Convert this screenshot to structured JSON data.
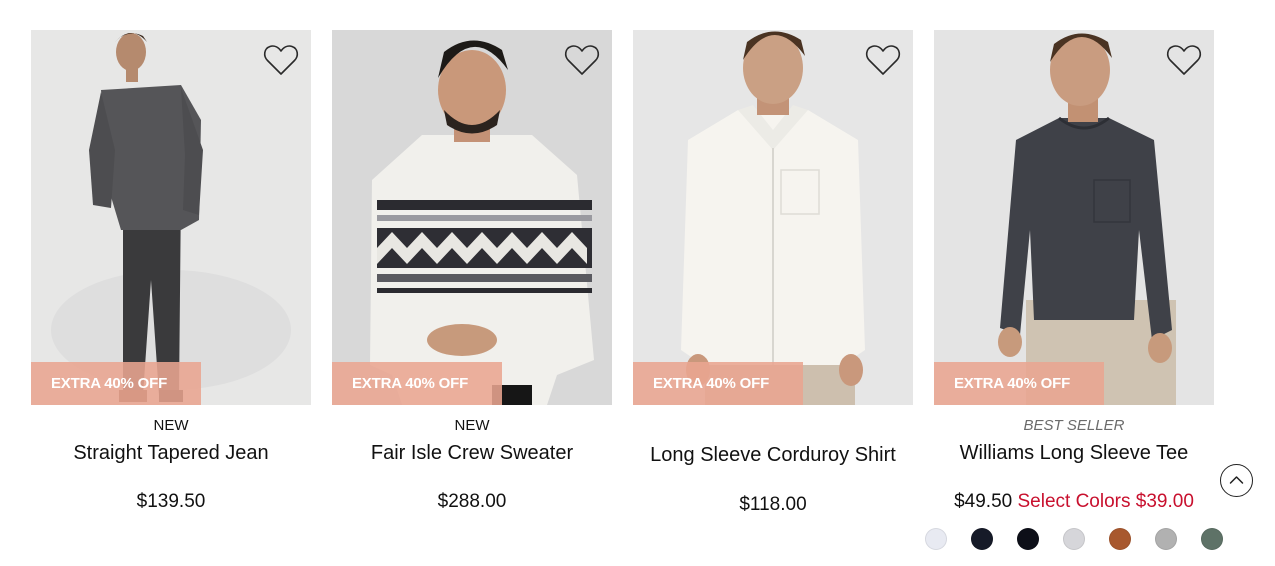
{
  "products": [
    {
      "badge": "NEW",
      "name": "Straight Tapered Jean",
      "price": "$139.50",
      "promo": "EXTRA 40% OFF",
      "image_icon": "model-in-dark-shirt-and-jeans-photo"
    },
    {
      "badge": "NEW",
      "name": "Fair Isle Crew Sweater",
      "price": "$288.00",
      "promo": "EXTRA 40% OFF",
      "image_icon": "model-in-fair-isle-sweater-photo"
    },
    {
      "badge": "",
      "name": "Long Sleeve Corduroy Shirt",
      "price": "$118.00",
      "promo": "EXTRA 40% OFF",
      "image_icon": "model-in-white-corduroy-shirt-photo"
    },
    {
      "badge": "BEST SELLER",
      "name": "Williams Long Sleeve Tee",
      "price": "$49.50",
      "sale_label": "Select Colors $39.00",
      "promo": "EXTRA 40% OFF",
      "image_icon": "model-in-charcoal-long-sleeve-tee-photo",
      "swatches": [
        "#e8eaf2",
        "#161a28",
        "#0d0f18",
        "#d6d6da",
        "#a8582e",
        "#b1b1b1",
        "#5e7267"
      ]
    }
  ],
  "icons": {
    "wishlist": "heart-outline-icon",
    "back_to_top": "chevron-up-circle-icon"
  },
  "colors": {
    "promo_bg": "#e9a591",
    "sale_red": "#c8102e",
    "photo_bg": "#e5e5e5"
  }
}
